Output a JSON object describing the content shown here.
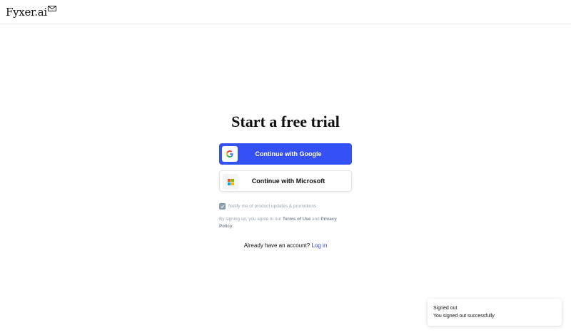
{
  "header": {
    "logo_text": "Fyxer.ai",
    "logo_icon": "envelope-icon"
  },
  "signup": {
    "title": "Start a free trial",
    "google_button_label": "Continue with Google",
    "google_icon": "google-g-icon",
    "microsoft_button_label": "Continue with Microsoft",
    "microsoft_icon": "microsoft-logo-icon",
    "notify_label": "Notify me of product updates & promotions",
    "notify_checked": true,
    "legal_prefix": "By signing up, you agree to our",
    "terms_link": "Terms of Use",
    "legal_and": "and",
    "privacy_link": "Privacy Policy",
    "legal_suffix": ".",
    "already_text": "Already have an account?",
    "login_link": "Log in"
  },
  "toast": {
    "title": "Signed out",
    "message": "You signed out successfully"
  },
  "colors": {
    "primary": "#3351f4",
    "link": "#2d4bdc",
    "muted_text": "#9aa3b2"
  }
}
